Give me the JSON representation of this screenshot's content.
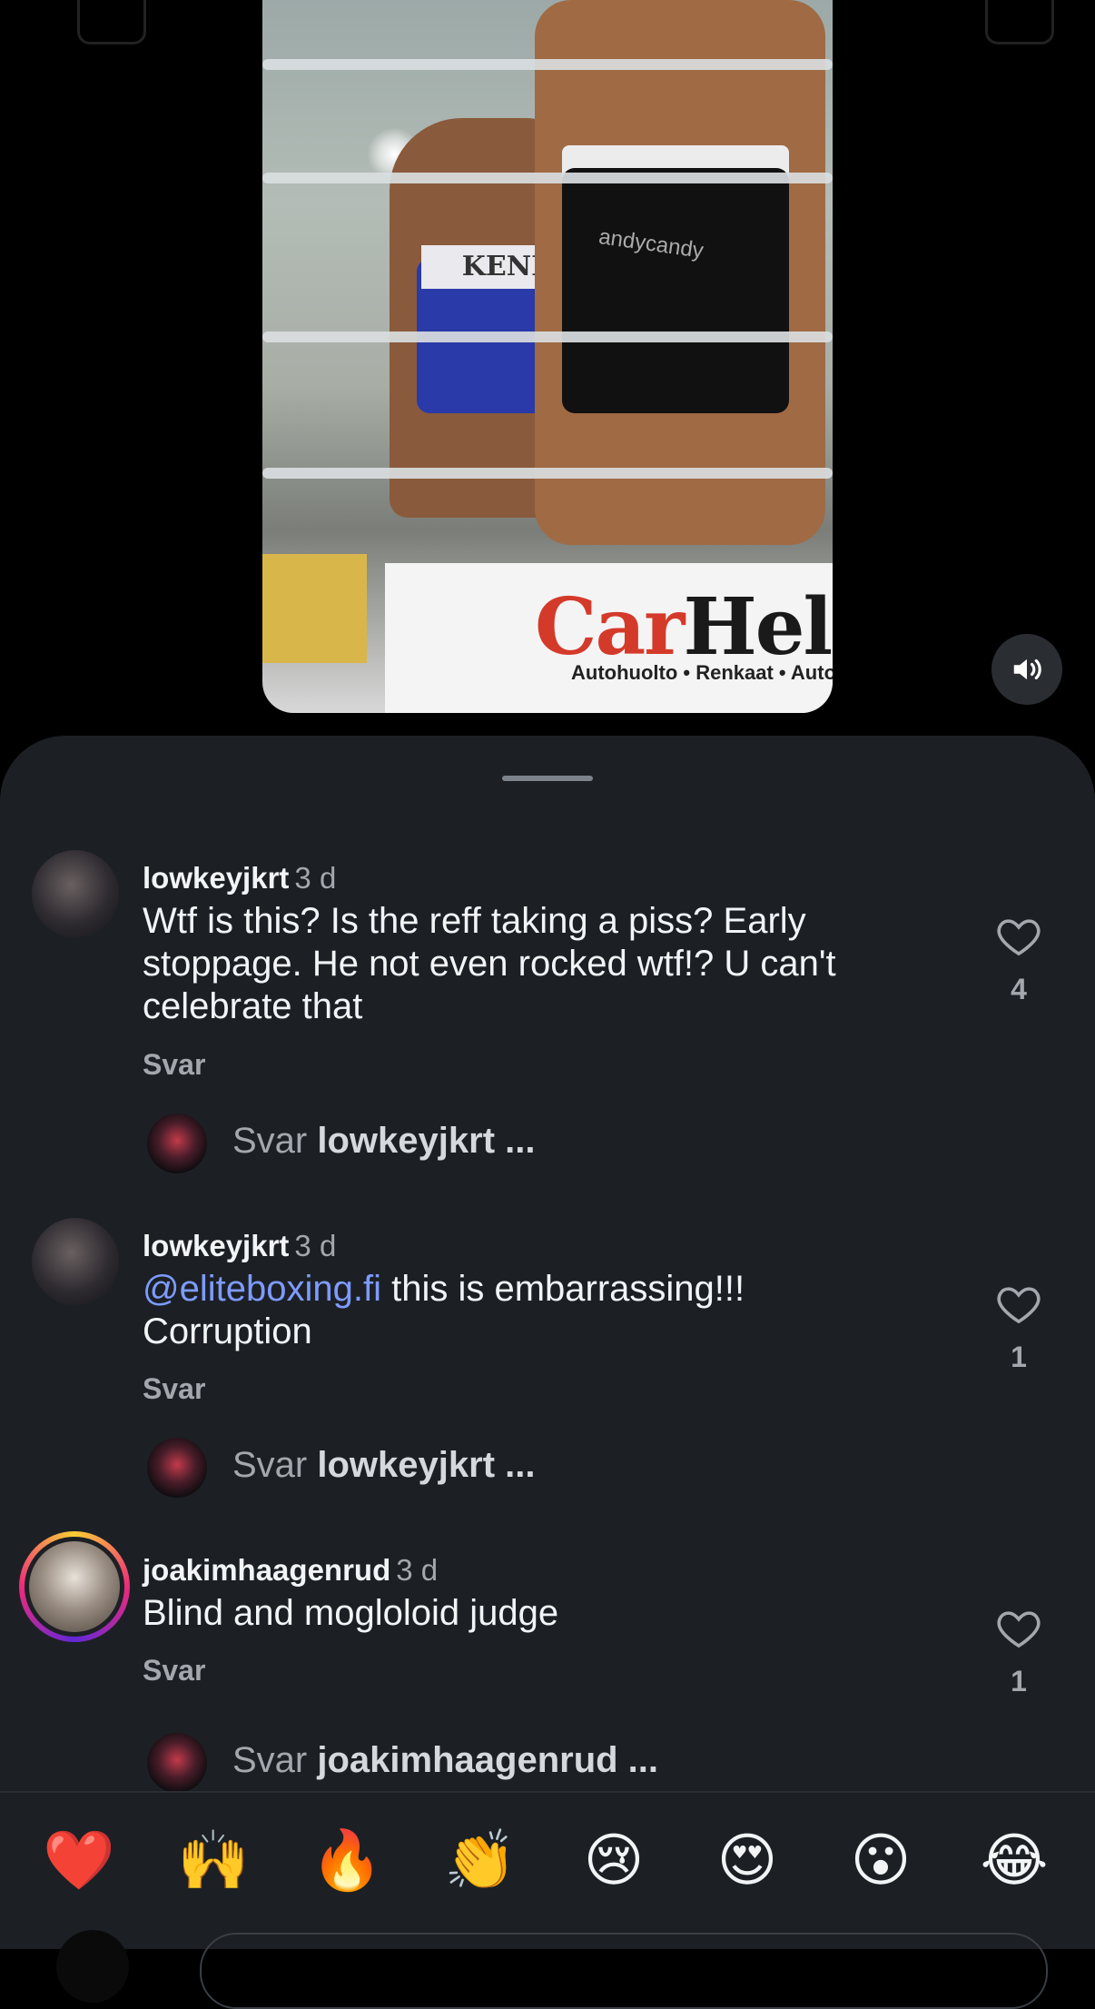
{
  "video": {
    "shorts_text_a": "KENI",
    "shorts_text_b": "andycandy",
    "banner_logo_main": "Car",
    "banner_logo_tail": "Hel",
    "banner_sub": "Autohuolto • Renkaat • Auto",
    "sound_icon": "speaker-icon"
  },
  "comments": [
    {
      "username": "lowkeyjkrt",
      "time": "3 d",
      "text": "Wtf is this? Is the reff taking a piss? Early stoppage. He not even rocked wtf!? U can't celebrate that",
      "reply_label": "Svar",
      "likes": "4",
      "reply_prompt": "Svar",
      "reply_target": "lowkeyjkrt ..."
    },
    {
      "username": "lowkeyjkrt",
      "time": "3 d",
      "mention": "@eliteboxing.fi",
      "text": " this is embarrassing!!! Corruption",
      "reply_label": "Svar",
      "likes": "1",
      "reply_prompt": "Svar",
      "reply_target": "lowkeyjkrt ..."
    },
    {
      "username": "joakimhaagenrud",
      "time": "3 d",
      "text": "Blind and mogloloid judge",
      "reply_label": "Svar",
      "likes": "1",
      "reply_prompt": "Svar",
      "reply_target": "joakimhaagenrud ..."
    }
  ],
  "emoji_bar": [
    "❤️",
    "🙌",
    "🔥",
    "👏",
    "😢",
    "😍",
    "😮",
    "😂"
  ],
  "colors": {
    "sheet_bg": "#1c2025",
    "mention": "#7e9bff",
    "muted": "#a3a8ae"
  }
}
